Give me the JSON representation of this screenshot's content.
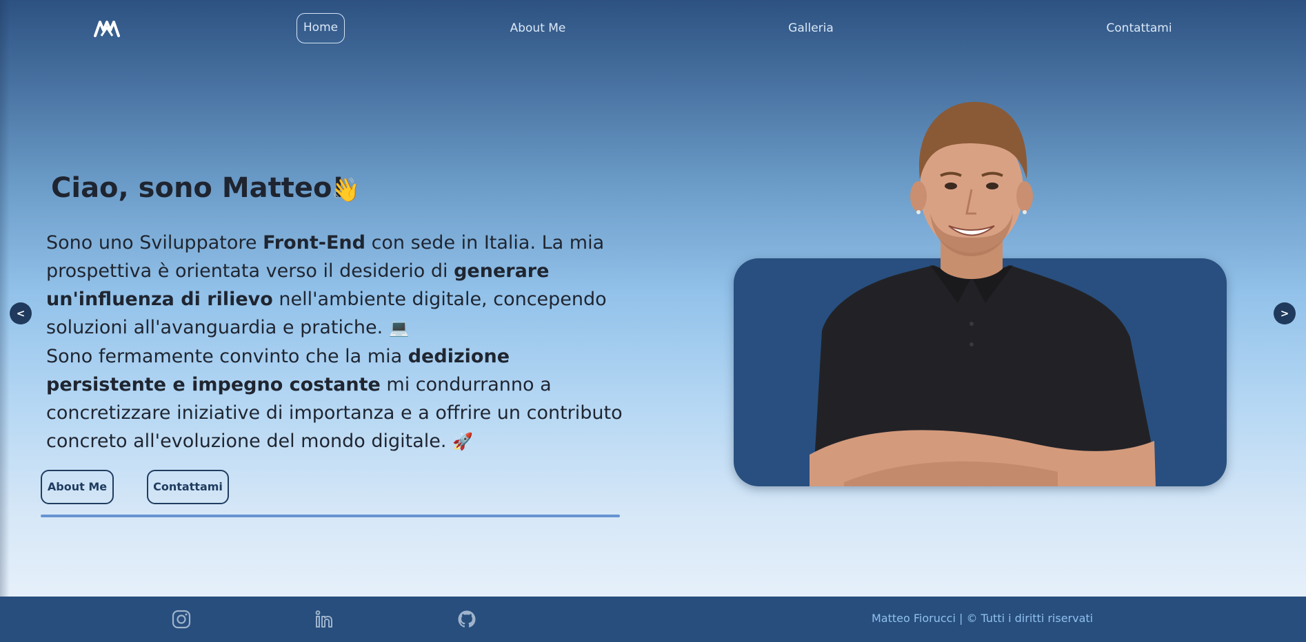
{
  "nav": {
    "items": [
      {
        "label": "Home",
        "active": true
      },
      {
        "label": "About Me"
      },
      {
        "label": "Galleria"
      },
      {
        "label": "Contattami"
      }
    ]
  },
  "hero": {
    "title": "Ciao, sono Matteo!",
    "wave_emoji": "👋",
    "paragraph1": {
      "t1": "Sono uno Sviluppatore ",
      "b1": "Front-End",
      "t2": " con sede in Italia. La mia prospettiva è orientata verso il desiderio di ",
      "b2": "generare un'influenza di rilievo",
      "t3": " nell'ambiente digitale, concependo soluzioni all'avanguardia e pratiche.",
      "emoji": "💻"
    },
    "paragraph2": {
      "t1": "Sono fermamente convinto che la mia ",
      "b1": "dedizione persistente e impegno costante",
      "t2": " mi condurranno a concretizzare iniziative di importanza e a offrire un contributo concreto all'evoluzione del mondo digitale.",
      "emoji": "🚀"
    },
    "buttons": {
      "about": "About Me",
      "contact": "Contattami"
    }
  },
  "carousel": {
    "prev": "<",
    "next": ">"
  },
  "footer": {
    "social_icons": [
      "instagram-icon",
      "linkedin-icon",
      "github-icon"
    ],
    "copyright": "Matteo Fiorucci | © Tutti i diritti riservati"
  },
  "colors": {
    "nav_text": "#dbe8f7",
    "card_bg": "#284f7f",
    "footer_bg": "#284e7d",
    "footer_text": "#8fc0ef",
    "heading_text": "#1f2530",
    "accent_line": "#6693d2"
  }
}
